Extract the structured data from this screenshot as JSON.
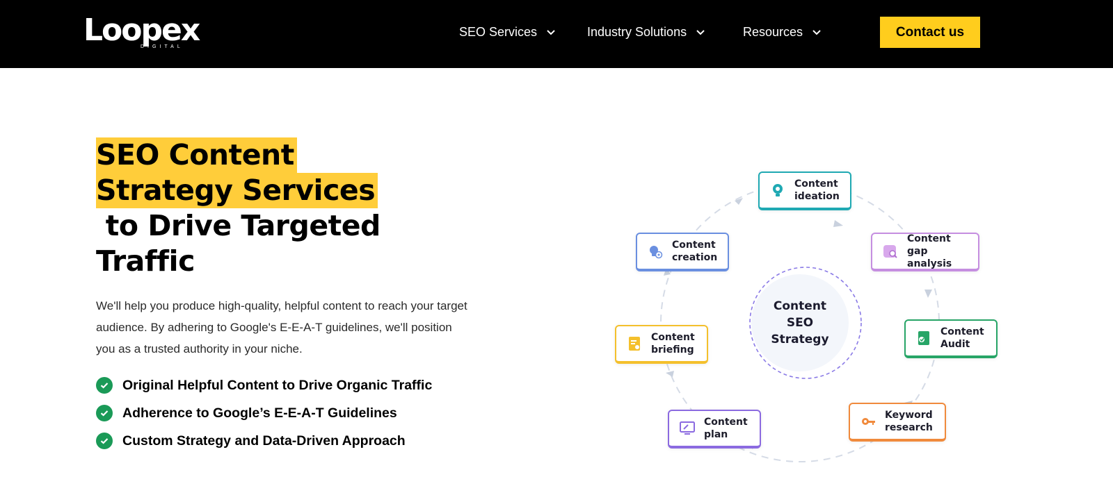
{
  "brand": {
    "logo_text": "Loopex",
    "logo_sub": "DIGITAL"
  },
  "nav": {
    "items": [
      {
        "label": "SEO Services"
      },
      {
        "label": "Industry Solutions"
      },
      {
        "label": "Resources"
      }
    ],
    "contact_label": "Contact us"
  },
  "hero": {
    "title_line1": "SEO Content",
    "title_line2": "Strategy Services",
    "title_line3": " to Drive Targeted",
    "title_line4": "Traffic",
    "description": "We'll help you produce high-quality, helpful content to reach your target audience. By adhering to Google's E-E-A-T guidelines, we'll position you as a trusted authority in your niche.",
    "bullets": [
      "Original Helpful Content to Drive Organic Traffic",
      "Adherence to Google’s E-E-A-T Guidelines",
      "Custom Strategy and Data-Driven Approach"
    ]
  },
  "diagram": {
    "center": "Content\nSEO\nStrategy",
    "nodes": [
      {
        "label": "Content\nideation",
        "icon": "lightbulb-icon",
        "color": "#1fa9b3"
      },
      {
        "label": "Content\ngap analysis",
        "icon": "search-doc-icon",
        "color": "#c58ee0"
      },
      {
        "label": "Content\nAudit",
        "icon": "audit-doc-icon",
        "color": "#27a567"
      },
      {
        "label": "Keyword\nresearch",
        "icon": "key-icon",
        "color": "#f08a3c"
      },
      {
        "label": "Content\nplan",
        "icon": "monitor-icon",
        "color": "#8b6ae0"
      },
      {
        "label": "Content\nbriefing",
        "icon": "brief-doc-icon",
        "color": "#f4c02c"
      },
      {
        "label": "Content\ncreation",
        "icon": "creation-bulb-icon",
        "color": "#6a8fe0"
      }
    ]
  },
  "colors": {
    "accent": "#ffcd1d",
    "check": "#1a9a57",
    "nav_bg": "#000000"
  }
}
